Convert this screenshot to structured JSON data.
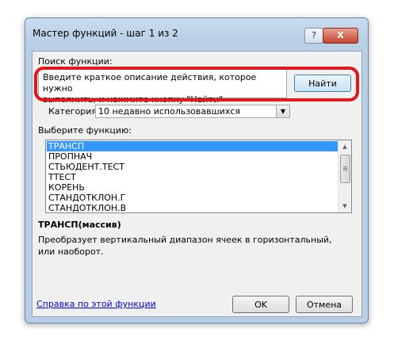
{
  "window": {
    "title": "Мастер функций - шаг 1 из 2",
    "help_glyph": "?",
    "close_glyph": "X"
  },
  "search": {
    "label": "Поиск функции:",
    "text_line1": "Введите краткое описание действия, которое нужно",
    "text_line2": "выполнить, и нажмите кнопку \"Найти\"",
    "find_button": "Найти"
  },
  "category": {
    "label": "Категория:",
    "value": "10 недавно использовавшихся",
    "arrow_glyph": "▼"
  },
  "functions": {
    "label": "Выберите функцию:",
    "items": [
      "ТРАНСП",
      "ПРОПНАЧ",
      "СТЬЮДЕНТ.ТЕСТ",
      "ТТЕСТ",
      "КОРЕНЬ",
      "СТАНДОТКЛОН.Г",
      "СТАНДОТКЛОН.В"
    ],
    "selected_index": 0
  },
  "details": {
    "signature": "ТРАНСП(массив)",
    "description": "Преобразует вертикальный диапазон ячеек в горизонтальный, или наоборот."
  },
  "footer": {
    "help_link": "Справка по этой функции",
    "ok_button": "OK",
    "cancel_button": "Отмена"
  },
  "colors": {
    "highlight_frame": "#e0191d",
    "selection": "#3399ff",
    "link": "#0000ee"
  }
}
